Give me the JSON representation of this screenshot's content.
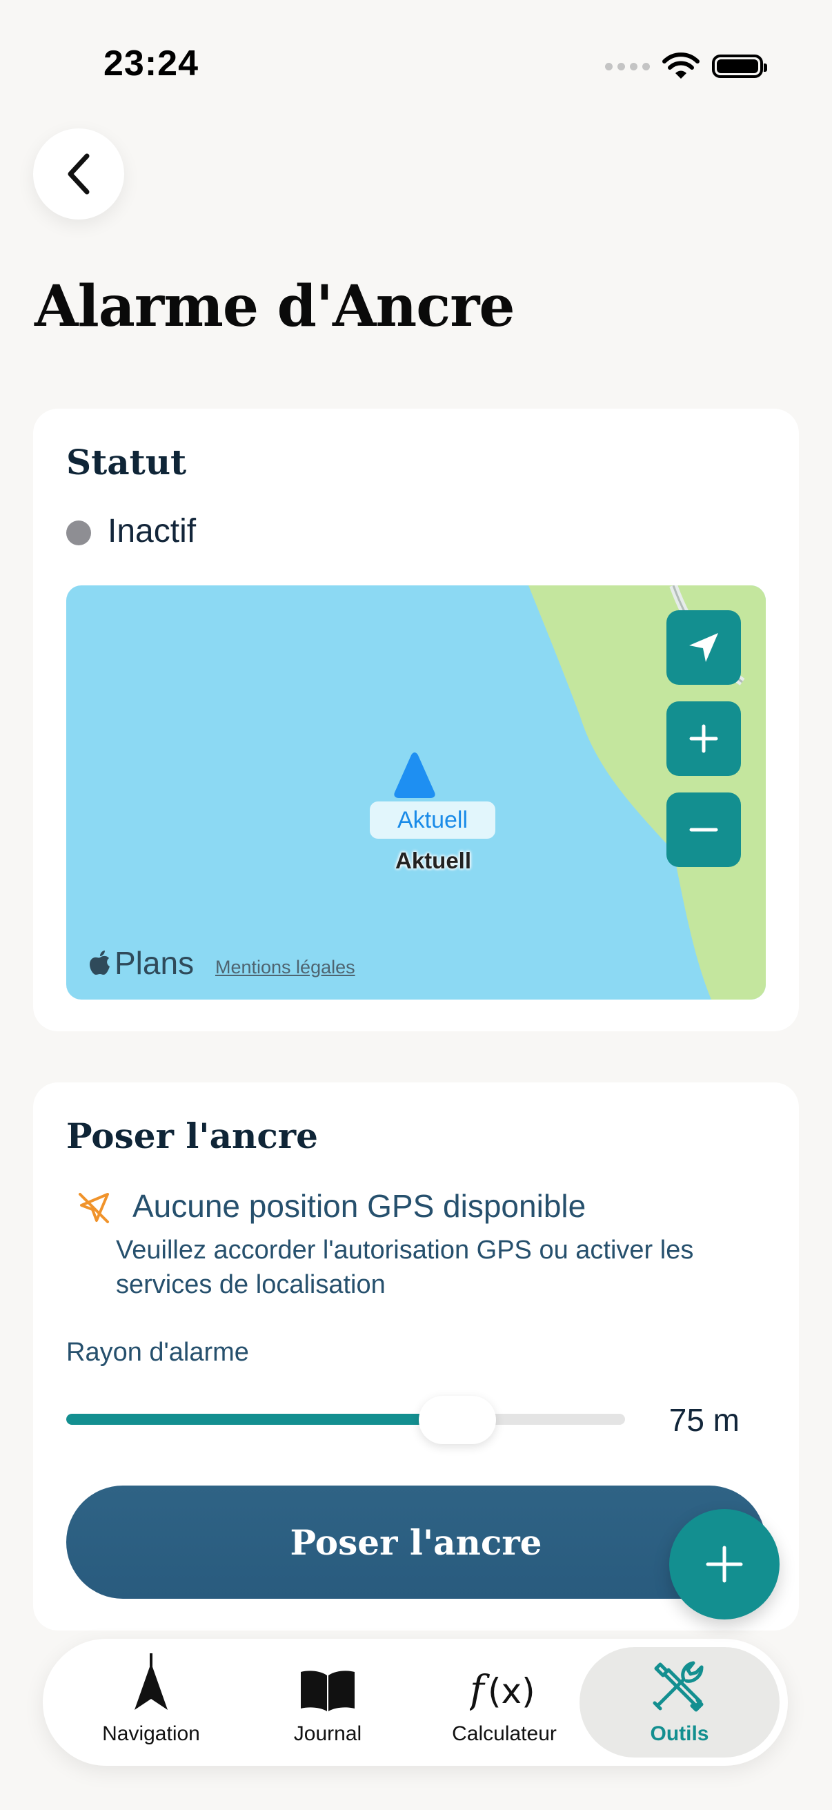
{
  "status_bar": {
    "time": "23:24"
  },
  "page": {
    "title": "Alarme d'Ancre"
  },
  "status_card": {
    "title": "Statut",
    "status": "Inactif",
    "status_color": "#8e8e93"
  },
  "map": {
    "pin_label": "Aktuell",
    "pin_caption": "Aktuell",
    "brand": "Plans",
    "legal": "Mentions légales",
    "buttons": [
      "location-arrow-icon",
      "zoom-in-icon",
      "zoom-out-icon"
    ]
  },
  "anchor_card": {
    "title": "Poser l'ancre",
    "gps_title": "Aucune position GPS disponible",
    "gps_desc": "Veuillez accorder l'autorisation GPS ou activer les services de localisation",
    "radius_label": "Rayon d'alarme",
    "radius_value": "75 m",
    "slider_fraction": 0.7,
    "button_label": "Poser l'ancre"
  },
  "tabs": [
    {
      "label": "Navigation",
      "icon": "navigation-icon",
      "active": false
    },
    {
      "label": "Journal",
      "icon": "book-icon",
      "active": false
    },
    {
      "label": "Calculateur",
      "icon": "function-icon",
      "active": false
    },
    {
      "label": "Outils",
      "icon": "tools-icon",
      "active": true
    }
  ],
  "colors": {
    "accent": "#138f90",
    "primary_button": "#2c5f82",
    "background": "#f8f7f5",
    "water": "#8cd9f3",
    "land": "#c4e69e",
    "warning": "#f0932b"
  }
}
